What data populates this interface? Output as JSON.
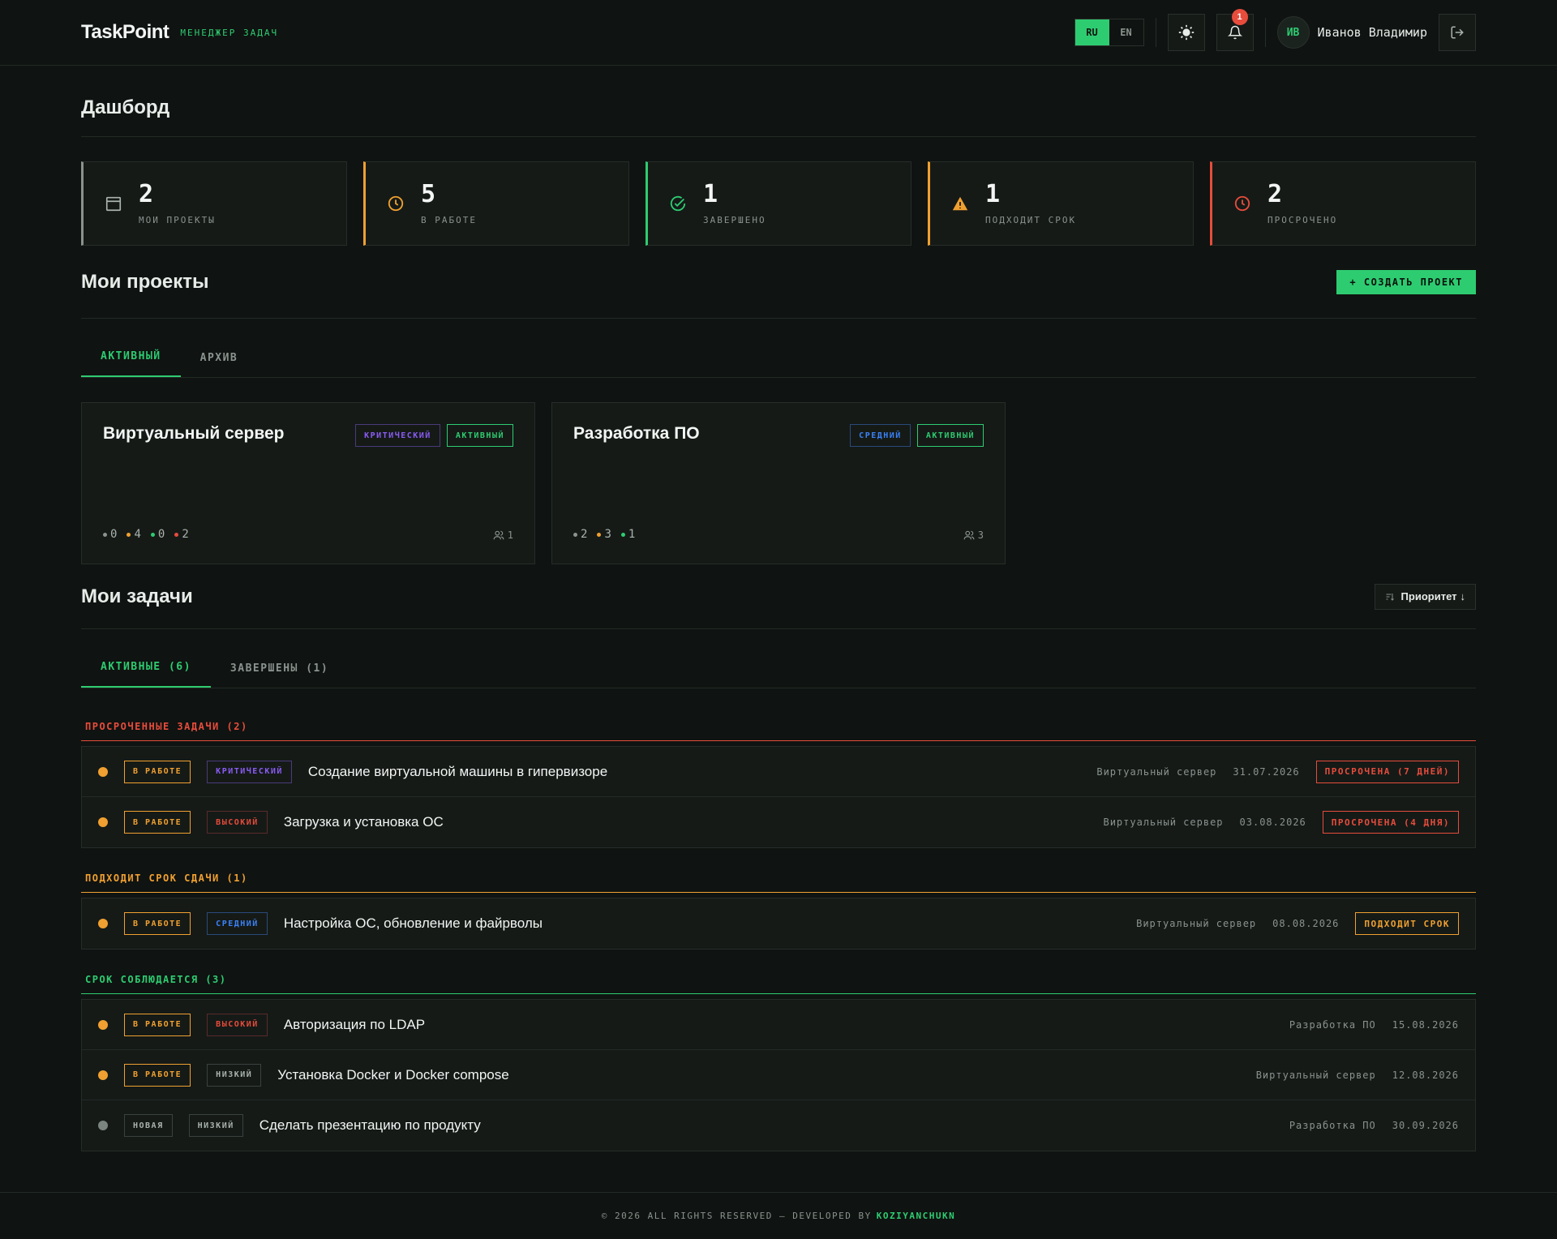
{
  "header": {
    "logo": "TaskPoint",
    "logo_sub": "МЕНЕДЖЕР ЗАДАЧ",
    "lang_ru": "RU",
    "lang_en": "EN",
    "notifications_count": "1",
    "avatar_initials": "ИВ",
    "user_name": "Иванов Владимир"
  },
  "dashboard": {
    "title": "Дашборд",
    "stats": [
      {
        "value": "2",
        "label": "МОИ ПРОЕКТЫ",
        "color": "#8a938e"
      },
      {
        "value": "5",
        "label": "В РАБОТЕ",
        "color": "#f0a030"
      },
      {
        "value": "1",
        "label": "ЗАВЕРШЕНО",
        "color": "#2ecc71"
      },
      {
        "value": "1",
        "label": "ПОДХОДИТ СРОК",
        "color": "#f0a030"
      },
      {
        "value": "2",
        "label": "ПРОСРОЧЕНО",
        "color": "#e74c3c"
      }
    ]
  },
  "projects": {
    "title": "Мои проекты",
    "create_button": "+ СОЗДАТЬ ПРОЕКТ",
    "tabs": [
      "АКТИВНЫЙ",
      "АРХИВ"
    ],
    "cards": [
      {
        "name": "Виртуальный сервер",
        "priority": "КРИТИЧЕСКИЙ",
        "status": "АКТИВНЫЙ",
        "counts": [
          "0",
          "4",
          "0",
          "2"
        ],
        "members": "1"
      },
      {
        "name": "Разработка ПО",
        "priority": "СРЕДНИЙ",
        "status": "АКТИВНЫЙ",
        "counts": [
          "2",
          "3",
          "1"
        ],
        "members": "3"
      }
    ]
  },
  "tasks": {
    "title": "Мои задачи",
    "sort_label": "Приоритет",
    "tabs": [
      "АКТИВНЫЕ (6)",
      "ЗАВЕРШЕНЫ (1)"
    ],
    "groups": [
      {
        "title": "ПРОСРОЧЕННЫЕ ЗАДАЧИ (2)",
        "items": [
          {
            "status": "В РАБОТЕ",
            "priority": "КРИТИЧЕСКИЙ",
            "name": "Создание виртуальной машины в гипервизоре",
            "project": "Виртуальный сервер",
            "date": "31.07.2026",
            "deadline": "ПРОСРОЧЕНА (7 ДНЕЙ)"
          },
          {
            "status": "В РАБОТЕ",
            "priority": "ВЫСОКИЙ",
            "name": "Загрузка и установка ОС",
            "project": "Виртуальный сервер",
            "date": "03.08.2026",
            "deadline": "ПРОСРОЧЕНА (4 ДНЯ)"
          }
        ]
      },
      {
        "title": "ПОДХОДИТ СРОК СДАЧИ (1)",
        "items": [
          {
            "status": "В РАБОТЕ",
            "priority": "СРЕДНИЙ",
            "name": "Настройка ОС, обновление и файрволы",
            "project": "Виртуальный сервер",
            "date": "08.08.2026",
            "deadline": "ПОДХОДИТ СРОК"
          }
        ]
      },
      {
        "title": "СРОК СОБЛЮДАЕТСЯ (3)",
        "items": [
          {
            "status": "В РАБОТЕ",
            "priority": "ВЫСОКИЙ",
            "name": "Авторизация по LDAP",
            "project": "Разработка ПО",
            "date": "15.08.2026"
          },
          {
            "status": "В РАБОТЕ",
            "priority": "НИЗКИЙ",
            "name": "Установка Docker и Docker compose",
            "project": "Виртуальный сервер",
            "date": "12.08.2026"
          },
          {
            "status": "НОВАЯ",
            "priority": "НИЗКИЙ",
            "name": "Сделать презентацию по продукту",
            "project": "Разработка ПО",
            "date": "30.09.2026"
          }
        ]
      }
    ]
  },
  "footer": {
    "text": "© 2026 ALL RIGHTS RESERVED — DEVELOPED BY",
    "author": "KOZIYANCHUKN"
  },
  "colors": {
    "accent": "#2ecc71",
    "in_progress": "#f0a030",
    "overdue": "#e74c3c",
    "critical": "#8a5cf6",
    "medium": "#3b82f6",
    "high": "#e74c3c",
    "low": "#8a938e"
  }
}
